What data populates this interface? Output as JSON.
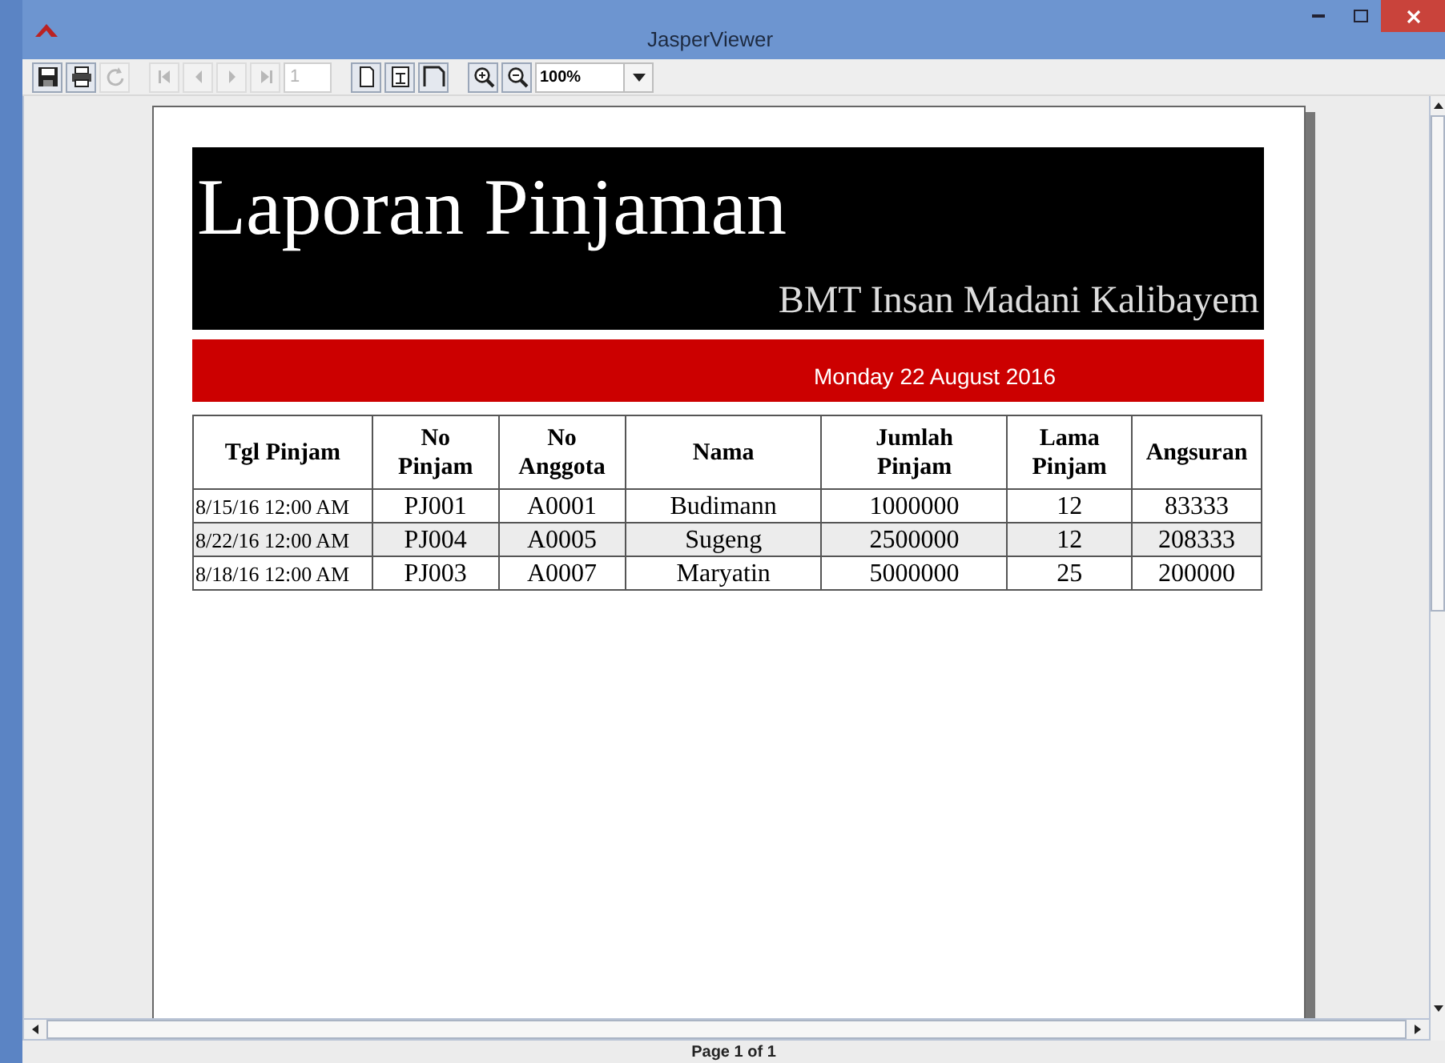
{
  "window": {
    "title": "JasperViewer"
  },
  "toolbar": [
    {
      "kind": "save",
      "disabled": false
    },
    {
      "kind": "print",
      "disabled": false
    },
    {
      "kind": "reload",
      "disabled": true
    },
    {
      "kind": "sep"
    },
    {
      "kind": "first",
      "disabled": true
    },
    {
      "kind": "prev",
      "disabled": true
    },
    {
      "kind": "next",
      "disabled": true
    },
    {
      "kind": "last",
      "disabled": true
    },
    {
      "kind": "page_field",
      "value": "1",
      "disabled": true
    },
    {
      "kind": "sep"
    },
    {
      "kind": "actual",
      "disabled": false
    },
    {
      "kind": "fit_page",
      "disabled": false
    },
    {
      "kind": "fit_width",
      "disabled": false
    },
    {
      "kind": "sep"
    },
    {
      "kind": "zoom_in",
      "disabled": false
    },
    {
      "kind": "zoom_out",
      "disabled": false
    },
    {
      "kind": "zoom_field",
      "value": "100%"
    }
  ],
  "report": {
    "title": "Laporan Pinjaman",
    "subtitle": "BMT Insan Madani Kalibayem",
    "date": "Monday 22 August 2016",
    "table": {
      "columns": [
        "Tgl Pinjam",
        "No\nPinjam",
        "No\nAnggota",
        "Nama",
        "Jumlah\nPinjam",
        "Lama\nPinjam",
        "Angsuran"
      ],
      "rows": [
        {
          "shaded": false,
          "cells": [
            "8/15/16 12:00 AM",
            "PJ001",
            "A0001",
            "Budimann",
            "1000000",
            "12",
            "83333"
          ]
        },
        {
          "shaded": true,
          "cells": [
            "8/22/16 12:00 AM",
            "PJ004",
            "A0005",
            "Sugeng",
            "2500000",
            "12",
            "208333"
          ]
        },
        {
          "shaded": false,
          "cells": [
            "8/18/16 12:00 AM",
            "PJ003",
            "A0007",
            "Maryatin",
            "5000000",
            "25",
            "200000"
          ]
        }
      ]
    }
  },
  "status_bar": {
    "text": "Page 1 of 1"
  }
}
